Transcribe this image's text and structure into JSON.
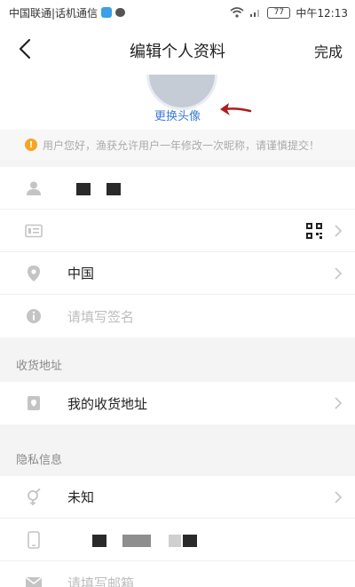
{
  "status_bar": {
    "carrier_text": "中国联通|话机通信",
    "battery": "77",
    "time": "中午12:13"
  },
  "navbar": {
    "title": "编辑个人资料",
    "done_label": "完成"
  },
  "avatar": {
    "change_label": "更换头像"
  },
  "notice": {
    "text": "用户您好，渔获允许用户一年修改一次昵称，请谨慎提交！"
  },
  "profile": {
    "region_value": "中国",
    "signature_placeholder": "请填写签名"
  },
  "address_section": {
    "header": "收货地址",
    "my_address_label": "我的收货地址"
  },
  "privacy_section": {
    "header": "隐私信息",
    "gender_value": "未知",
    "email_placeholder": "请填写邮箱"
  },
  "colors": {
    "accent_link": "#3d7bd6",
    "arrow_annotation": "#b01c1c",
    "warning": "#f5a623"
  },
  "icons": [
    "back-arrow-icon",
    "person-icon",
    "id-card-icon",
    "qr-code-icon",
    "location-pin-icon",
    "info-icon",
    "address-book-icon",
    "gender-icon",
    "phone-icon",
    "mail-icon",
    "chevron-right-icon",
    "warning-icon"
  ]
}
